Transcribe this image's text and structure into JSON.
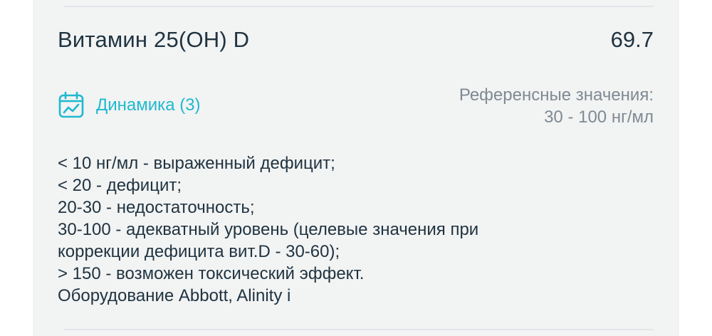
{
  "result": {
    "test_name": "Витамин 25(OH) D",
    "value": "69.7"
  },
  "dynamics": {
    "icon": "calendar-chart-icon",
    "label": "Динамика (3)"
  },
  "reference": {
    "title": "Референсные значения:",
    "range": "30 - 100 нг/мл"
  },
  "notes": [
    "< 10 нг/мл - выраженный дефицит;",
    "< 20 - дефицит;",
    "20-30 - недостаточность;",
    "30-100 - адекватный уровень (целевые значения при",
    "коррекции дефицита вит.D - 30-60);",
    "> 150 - возможен токсический эффект.",
    "Оборудование Abbott, Alinity i"
  ],
  "colors": {
    "card_background": "#f2f3f3",
    "text_primary": "#1f3340",
    "text_secondary": "#7f8a93",
    "accent": "#20b9cf"
  }
}
